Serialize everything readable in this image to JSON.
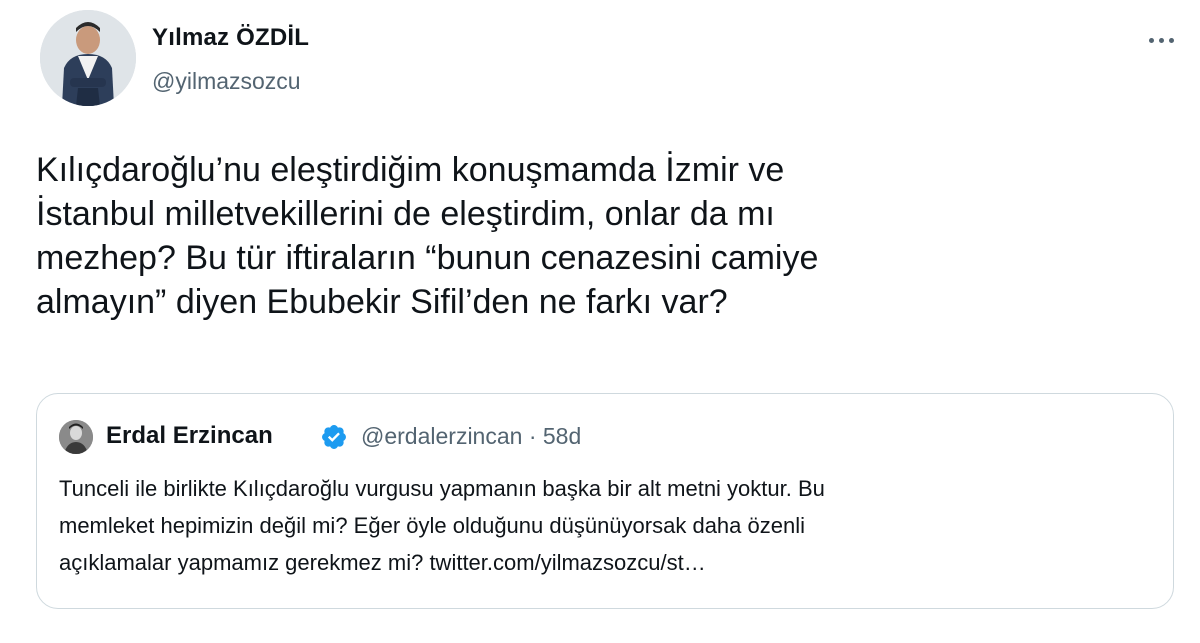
{
  "tweet": {
    "author_name": "Yılmaz ÖZDİL",
    "author_handle": "@yilmazsozcu",
    "text_lines": [
      "Kılıçdaroğlu’nu eleştirdiğim konuşmamda İzmir ve",
      "İstanbul milletvekillerini de eleştirdim, onlar da mı",
      "mezhep? Bu tür iftiraların “bunun cenazesini camiye",
      "almayın” diyen Ebubekir Sifil’den ne farkı var?"
    ]
  },
  "quoted": {
    "author_name": "Erdal Erzincan",
    "author_handle": "@erdalerzincan",
    "separator": "·",
    "time": "58d",
    "text_lines": [
      "Tunceli ile birlikte Kılıçdaroğlu vurgusu yapmanın başka bir alt metni yoktur. Bu",
      "memleket hepimizin  değil mi? Eğer öyle olduğunu düşünüyorsak  daha özenli",
      "açıklamalar yapmamız gerekmez mi? twitter.com/yilmazsozcu/st…"
    ]
  },
  "icons": {
    "more": "more-horizontal-icon",
    "verified": "verified-badge-icon"
  },
  "colors": {
    "text": "#0f1419",
    "secondary": "#536471",
    "border": "#cfd9de",
    "verified": "#1d9bf0"
  }
}
